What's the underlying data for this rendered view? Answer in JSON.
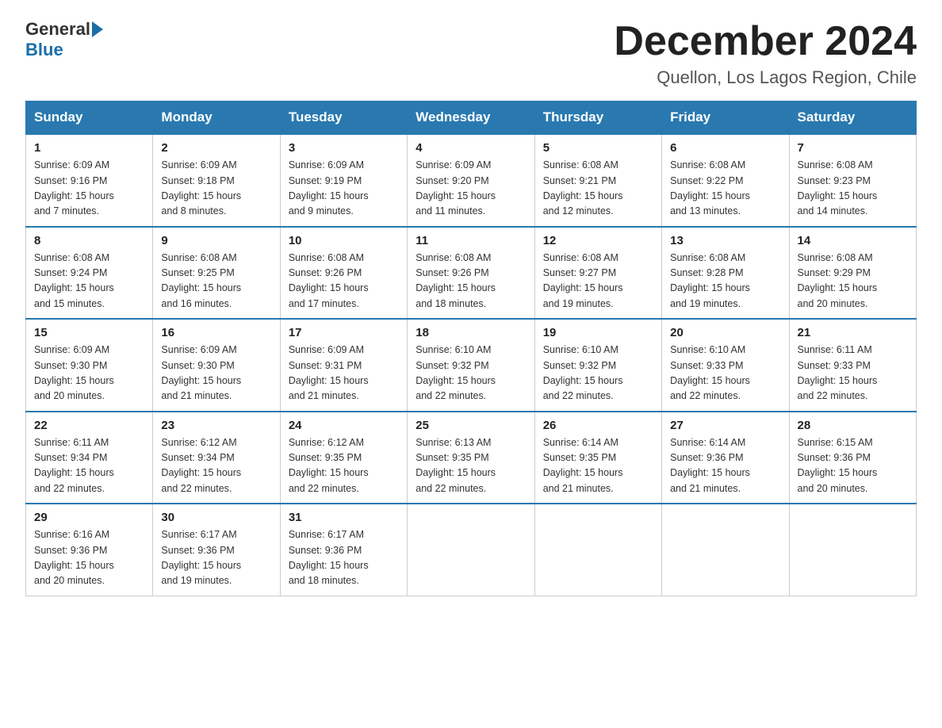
{
  "logo": {
    "general": "General",
    "blue": "Blue"
  },
  "title": "December 2024",
  "location": "Quellon, Los Lagos Region, Chile",
  "headers": [
    "Sunday",
    "Monday",
    "Tuesday",
    "Wednesday",
    "Thursday",
    "Friday",
    "Saturday"
  ],
  "weeks": [
    [
      {
        "day": "1",
        "sunrise": "6:09 AM",
        "sunset": "9:16 PM",
        "daylight": "15 hours and 7 minutes."
      },
      {
        "day": "2",
        "sunrise": "6:09 AM",
        "sunset": "9:18 PM",
        "daylight": "15 hours and 8 minutes."
      },
      {
        "day": "3",
        "sunrise": "6:09 AM",
        "sunset": "9:19 PM",
        "daylight": "15 hours and 9 minutes."
      },
      {
        "day": "4",
        "sunrise": "6:09 AM",
        "sunset": "9:20 PM",
        "daylight": "15 hours and 11 minutes."
      },
      {
        "day": "5",
        "sunrise": "6:08 AM",
        "sunset": "9:21 PM",
        "daylight": "15 hours and 12 minutes."
      },
      {
        "day": "6",
        "sunrise": "6:08 AM",
        "sunset": "9:22 PM",
        "daylight": "15 hours and 13 minutes."
      },
      {
        "day": "7",
        "sunrise": "6:08 AM",
        "sunset": "9:23 PM",
        "daylight": "15 hours and 14 minutes."
      }
    ],
    [
      {
        "day": "8",
        "sunrise": "6:08 AM",
        "sunset": "9:24 PM",
        "daylight": "15 hours and 15 minutes."
      },
      {
        "day": "9",
        "sunrise": "6:08 AM",
        "sunset": "9:25 PM",
        "daylight": "15 hours and 16 minutes."
      },
      {
        "day": "10",
        "sunrise": "6:08 AM",
        "sunset": "9:26 PM",
        "daylight": "15 hours and 17 minutes."
      },
      {
        "day": "11",
        "sunrise": "6:08 AM",
        "sunset": "9:26 PM",
        "daylight": "15 hours and 18 minutes."
      },
      {
        "day": "12",
        "sunrise": "6:08 AM",
        "sunset": "9:27 PM",
        "daylight": "15 hours and 19 minutes."
      },
      {
        "day": "13",
        "sunrise": "6:08 AM",
        "sunset": "9:28 PM",
        "daylight": "15 hours and 19 minutes."
      },
      {
        "day": "14",
        "sunrise": "6:08 AM",
        "sunset": "9:29 PM",
        "daylight": "15 hours and 20 minutes."
      }
    ],
    [
      {
        "day": "15",
        "sunrise": "6:09 AM",
        "sunset": "9:30 PM",
        "daylight": "15 hours and 20 minutes."
      },
      {
        "day": "16",
        "sunrise": "6:09 AM",
        "sunset": "9:30 PM",
        "daylight": "15 hours and 21 minutes."
      },
      {
        "day": "17",
        "sunrise": "6:09 AM",
        "sunset": "9:31 PM",
        "daylight": "15 hours and 21 minutes."
      },
      {
        "day": "18",
        "sunrise": "6:10 AM",
        "sunset": "9:32 PM",
        "daylight": "15 hours and 22 minutes."
      },
      {
        "day": "19",
        "sunrise": "6:10 AM",
        "sunset": "9:32 PM",
        "daylight": "15 hours and 22 minutes."
      },
      {
        "day": "20",
        "sunrise": "6:10 AM",
        "sunset": "9:33 PM",
        "daylight": "15 hours and 22 minutes."
      },
      {
        "day": "21",
        "sunrise": "6:11 AM",
        "sunset": "9:33 PM",
        "daylight": "15 hours and 22 minutes."
      }
    ],
    [
      {
        "day": "22",
        "sunrise": "6:11 AM",
        "sunset": "9:34 PM",
        "daylight": "15 hours and 22 minutes."
      },
      {
        "day": "23",
        "sunrise": "6:12 AM",
        "sunset": "9:34 PM",
        "daylight": "15 hours and 22 minutes."
      },
      {
        "day": "24",
        "sunrise": "6:12 AM",
        "sunset": "9:35 PM",
        "daylight": "15 hours and 22 minutes."
      },
      {
        "day": "25",
        "sunrise": "6:13 AM",
        "sunset": "9:35 PM",
        "daylight": "15 hours and 22 minutes."
      },
      {
        "day": "26",
        "sunrise": "6:14 AM",
        "sunset": "9:35 PM",
        "daylight": "15 hours and 21 minutes."
      },
      {
        "day": "27",
        "sunrise": "6:14 AM",
        "sunset": "9:36 PM",
        "daylight": "15 hours and 21 minutes."
      },
      {
        "day": "28",
        "sunrise": "6:15 AM",
        "sunset": "9:36 PM",
        "daylight": "15 hours and 20 minutes."
      }
    ],
    [
      {
        "day": "29",
        "sunrise": "6:16 AM",
        "sunset": "9:36 PM",
        "daylight": "15 hours and 20 minutes."
      },
      {
        "day": "30",
        "sunrise": "6:17 AM",
        "sunset": "9:36 PM",
        "daylight": "15 hours and 19 minutes."
      },
      {
        "day": "31",
        "sunrise": "6:17 AM",
        "sunset": "9:36 PM",
        "daylight": "15 hours and 18 minutes."
      },
      null,
      null,
      null,
      null
    ]
  ],
  "labels": {
    "sunrise": "Sunrise:",
    "sunset": "Sunset:",
    "daylight": "Daylight:"
  }
}
